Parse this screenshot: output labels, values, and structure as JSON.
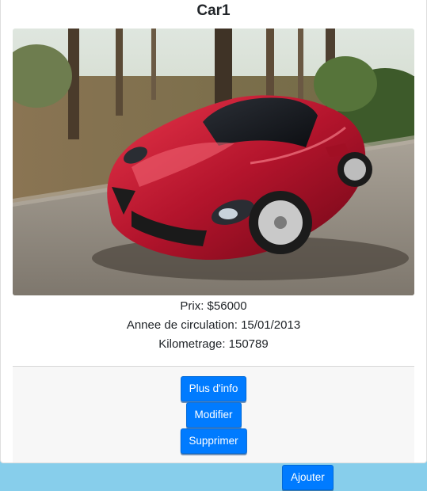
{
  "card": {
    "title": "Car1",
    "image_alt": "Red sports car driving on a road",
    "price_line": "Prix: $56000",
    "date_line": "Annee de circulation: 15/01/2013",
    "mileage_line": "Kilometrage: 150789"
  },
  "actions": {
    "more_info": "Plus d'info",
    "edit": "Modifier",
    "delete": "Supprimer"
  },
  "bottom_bar": {
    "add": "Ajouter"
  },
  "colors": {
    "page_background": "#87ceeb",
    "primary_button": "#007bff",
    "card_footer": "#f7f7f7"
  }
}
